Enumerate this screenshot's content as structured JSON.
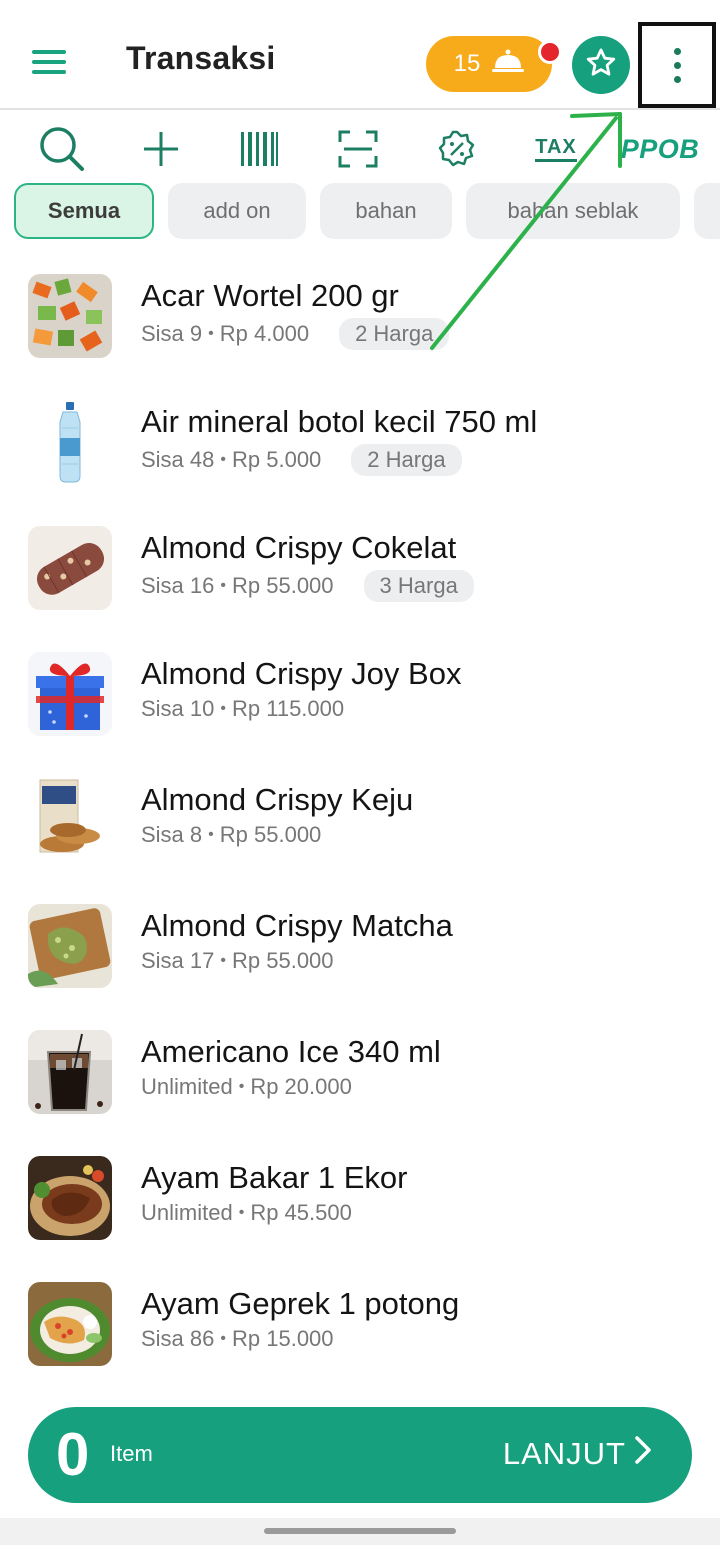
{
  "header": {
    "title": "Transaksi",
    "orders_count": "15"
  },
  "toolbar": {
    "tax_label": "TAX",
    "ppob_label": "PPOB"
  },
  "categories": [
    {
      "label": "Semua",
      "active": true
    },
    {
      "label": "add on",
      "active": false
    },
    {
      "label": "bahan",
      "active": false
    },
    {
      "label": "bahan seblak",
      "active": false
    }
  ],
  "products": [
    {
      "name": "Acar Wortel 200 gr",
      "stock": "Sisa 9",
      "price": "Rp 4.000",
      "variants": "2 Harga"
    },
    {
      "name": "Air mineral botol kecil 750 ml",
      "stock": "Sisa 48",
      "price": "Rp 5.000",
      "variants": "2 Harga"
    },
    {
      "name": "Almond Crispy Cokelat",
      "stock": "Sisa 16",
      "price": "Rp 55.000",
      "variants": "3 Harga"
    },
    {
      "name": "Almond Crispy Joy Box",
      "stock": "Sisa 10",
      "price": "Rp 115.000",
      "variants": ""
    },
    {
      "name": "Almond Crispy Keju",
      "stock": "Sisa 8",
      "price": "Rp 55.000",
      "variants": ""
    },
    {
      "name": "Almond Crispy Matcha",
      "stock": "Sisa 17",
      "price": "Rp 55.000",
      "variants": ""
    },
    {
      "name": "Americano Ice 340 ml",
      "stock": "Unlimited",
      "price": "Rp 20.000",
      "variants": ""
    },
    {
      "name": "Ayam Bakar  1 Ekor",
      "stock": "Unlimited",
      "price": "Rp 45.500",
      "variants": ""
    },
    {
      "name": "Ayam Geprek 1 potong",
      "stock": "Sisa 86",
      "price": "Rp 15.000",
      "variants": ""
    }
  ],
  "checkout": {
    "count": "0",
    "item_label": "Item",
    "action_label": "LANJUT"
  },
  "meta_separator": "•",
  "colors": {
    "brand_green": "#17a07d",
    "orders_orange": "#f7ab1b",
    "badge_red": "#e3262b",
    "annotation_arrow": "#2db24b"
  }
}
